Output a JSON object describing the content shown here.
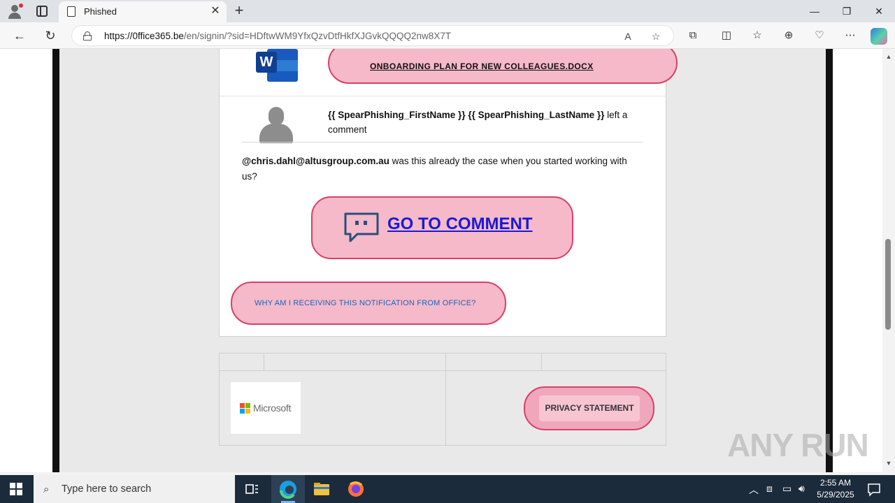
{
  "browser": {
    "tab_title": "Phished",
    "url_host": "https://0ffice365.be",
    "url_path": "/en/signin/?sid=HDftwWM9YfxQzvDtfHkfXJGvkQQQQ2nw8X7T",
    "window_controls": [
      "—",
      "❐",
      "✕"
    ]
  },
  "email": {
    "document_link": "ONBOARDING PLAN FOR NEW COLLEAGUES.DOCX",
    "commenter_name": "{{ SpearPhishing_FirstName }} {{ SpearPhishing_LastName }}",
    "commenter_action": " left a comment",
    "mention": "@chris.dahl@altusgroup.com.au",
    "comment_text": " was this already the case when you started working with us?",
    "go_to_comment": "GO TO COMMENT",
    "why_link": "WHY AM I RECEIVING THIS NOTIFICATION FROM OFFICE?",
    "footer_brand": "Microsoft",
    "privacy": "PRIVACY STATEMENT"
  },
  "watermark": "ANY RUN",
  "taskbar": {
    "search_placeholder": "Type here to search",
    "time": "2:55 AM",
    "date": "5/29/2025"
  },
  "colors": {
    "pill_fill": "#f5b9c9",
    "pill_border": "#d8406a",
    "link_blue": "#1a1ad4",
    "taskbar_bg": "#1c2b3b"
  }
}
